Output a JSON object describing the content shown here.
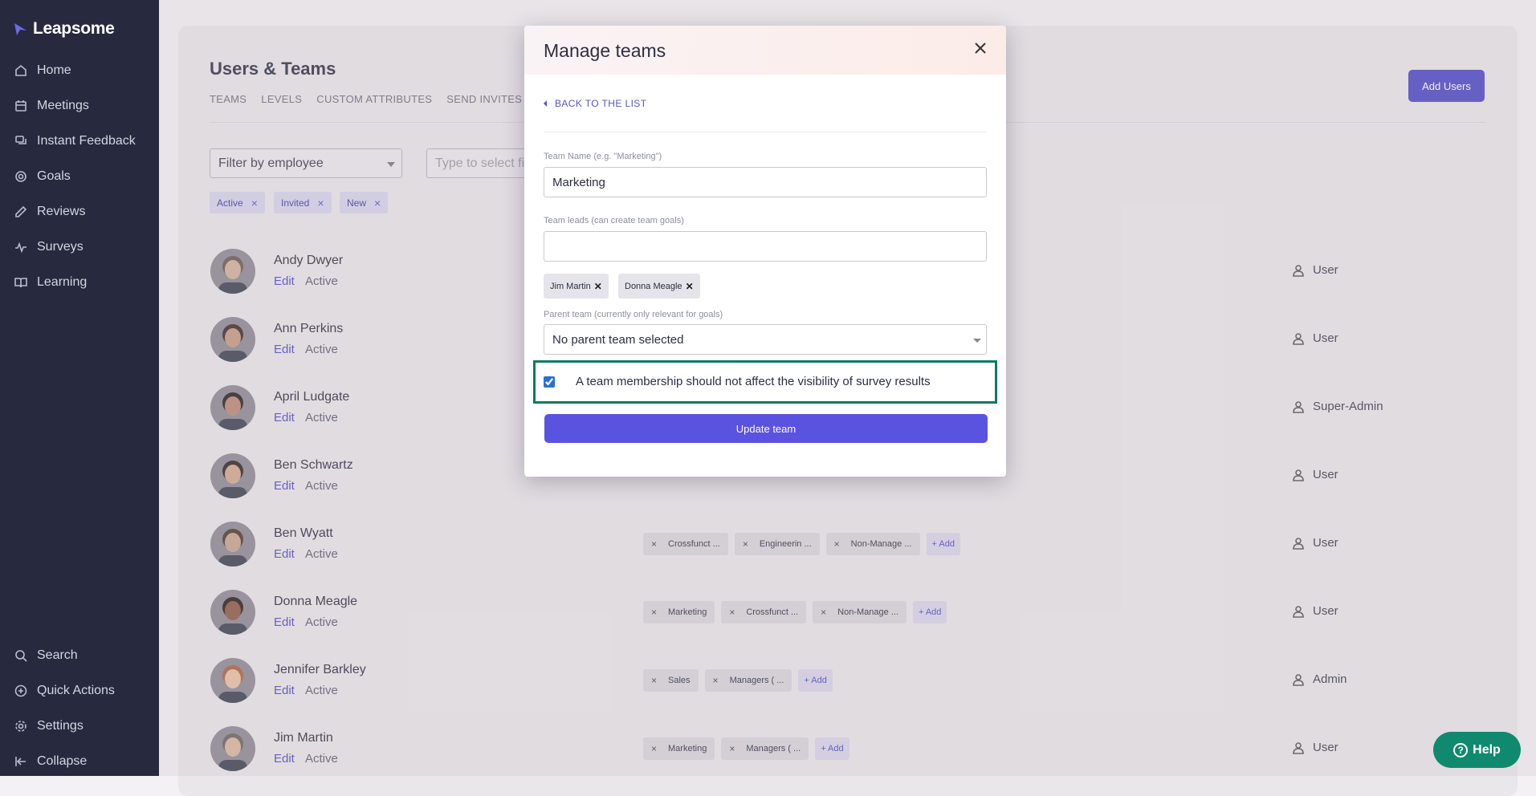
{
  "app": {
    "logo_text": "Leapsome"
  },
  "sidebar": {
    "items": [
      {
        "label": "Home",
        "icon": "home-icon"
      },
      {
        "label": "Meetings",
        "icon": "calendar-icon"
      },
      {
        "label": "Instant Feedback",
        "icon": "chat-icon"
      },
      {
        "label": "Goals",
        "icon": "target-icon"
      },
      {
        "label": "Reviews",
        "icon": "edit-icon"
      },
      {
        "label": "Surveys",
        "icon": "pulse-icon"
      },
      {
        "label": "Learning",
        "icon": "book-icon"
      }
    ],
    "bottom_items": [
      {
        "label": "Search",
        "icon": "search-icon"
      },
      {
        "label": "Quick Actions",
        "icon": "plus-circle-icon"
      },
      {
        "label": "Settings",
        "icon": "gear-icon"
      },
      {
        "label": "Collapse",
        "icon": "collapse-icon"
      }
    ]
  },
  "page": {
    "title": "Users & Teams",
    "tabs": [
      "TEAMS",
      "LEVELS",
      "CUSTOM ATTRIBUTES",
      "SEND INVITES"
    ],
    "add_users_label": "Add Users",
    "filter_placeholder": "Filter by employee",
    "type_placeholder": "Type to select fi",
    "status_filters": [
      "Active",
      "Invited",
      "New"
    ]
  },
  "users": [
    {
      "name": "Andy Dwyer",
      "edit": "Edit",
      "status": "Active",
      "role": "User",
      "teams": [],
      "add": ""
    },
    {
      "name": "Ann Perkins",
      "edit": "Edit",
      "status": "Active",
      "role": "User",
      "teams": [],
      "add": ""
    },
    {
      "name": "April Ludgate",
      "edit": "Edit",
      "status": "Active",
      "role": "Super-Admin",
      "teams": [],
      "add": ""
    },
    {
      "name": "Ben Schwartz",
      "edit": "Edit",
      "status": "Active",
      "role": "User",
      "teams": [],
      "add": ""
    },
    {
      "name": "Ben Wyatt",
      "edit": "Edit",
      "status": "Active",
      "role": "User",
      "teams": [
        "Crossfunct ...",
        "Engineerin ...",
        "Non-Manage ..."
      ],
      "add": "+ Add"
    },
    {
      "name": "Donna Meagle",
      "edit": "Edit",
      "status": "Active",
      "role": "User",
      "teams": [
        "Marketing",
        "Crossfunct ...",
        "Non-Manage ..."
      ],
      "add": "+ Add"
    },
    {
      "name": "Jennifer Barkley",
      "edit": "Edit",
      "status": "Active",
      "role": "Admin",
      "teams": [
        "Sales",
        "Managers ( ..."
      ],
      "add": "+ Add"
    },
    {
      "name": "Jim Martin",
      "edit": "Edit",
      "status": "Active",
      "role": "User",
      "teams": [
        "Marketing",
        "Managers ( ..."
      ],
      "add": "+ Add"
    }
  ],
  "modal": {
    "title": "Manage teams",
    "back_label": "BACK TO THE LIST",
    "team_name_label": "Team Name (e.g. \"Marketing\")",
    "team_name_value": "Marketing",
    "team_leads_label": "Team leads (can create team goals)",
    "team_leads_value": "",
    "leads": [
      "Jim Martin",
      "Donna Meagle"
    ],
    "parent_label": "Parent team (currently only relevant for goals)",
    "parent_value": "No parent team selected",
    "checkbox_label": "A team membership should not affect the visibility of survey results",
    "checkbox_checked": true,
    "update_label": "Update team"
  },
  "help": {
    "label": "Help"
  }
}
